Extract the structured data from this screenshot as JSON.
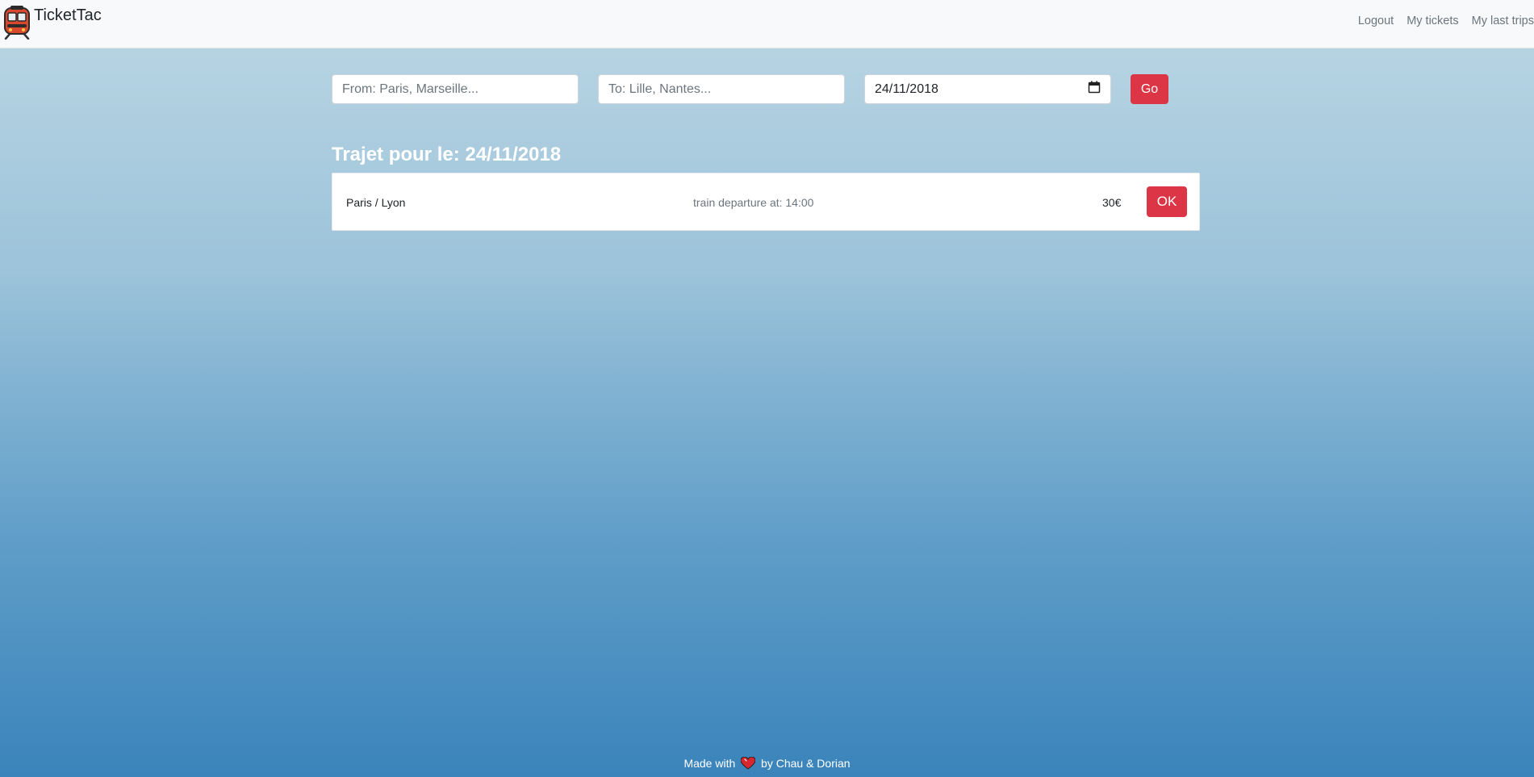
{
  "navbar": {
    "logo_icon": "train-icon",
    "brand": "TicketTac",
    "links": [
      "Logout",
      "My tickets",
      "My last trips"
    ]
  },
  "search": {
    "from_placeholder": "From: Paris, Marseille...",
    "to_placeholder": "To: Lille, Nantes...",
    "date_value": "24/11/2018",
    "date_icon": "calendar-icon",
    "go_label": "Go"
  },
  "results": {
    "heading": "Trajet pour le: 24/11/2018",
    "trips": [
      {
        "route": "Paris / Lyon",
        "departure": "train departure at: 14:00",
        "price": "30€",
        "action": "OK"
      }
    ]
  },
  "footer": {
    "prefix": "Made with",
    "icon": "heart-icon",
    "suffix": "by Chau & Dorian"
  },
  "colors": {
    "accent": "#dc3545",
    "navbar_bg": "#f8f9fa",
    "gradient_top": "#bcd7e4",
    "gradient_bottom": "#3a84bb"
  }
}
